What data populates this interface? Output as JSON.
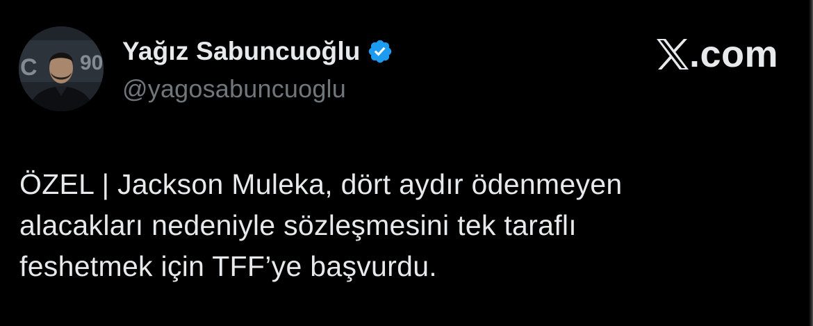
{
  "author": {
    "display_name": "Yağız Sabuncuoğlu",
    "handle": "@yagosabuncuoglu",
    "verified": true,
    "avatar_icon": "profile-photo"
  },
  "brand": {
    "suffix": ".com",
    "logo_icon": "x-logo-icon"
  },
  "tweet": {
    "lines": [
      "ÖZEL | Jackson Muleka, dört aydır ödenmeyen",
      "alacakları nedeniyle sözleşmesini tek taraflı",
      "feshetmek için TFF’ye başvurdu."
    ]
  },
  "colors": {
    "background": "#000000",
    "text_primary": "#e7e9ea",
    "text_secondary": "#71767b",
    "verified_badge": "#1d9bf0"
  }
}
